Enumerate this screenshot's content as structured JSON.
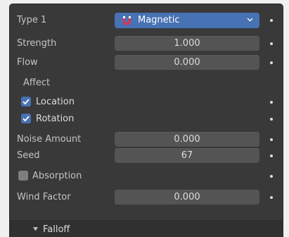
{
  "type": {
    "label": "Type 1",
    "value": "Magnetic",
    "icon": "magnet-icon"
  },
  "strength": {
    "label": "Strength",
    "value": "1.000"
  },
  "flow": {
    "label": "Flow",
    "value": "0.000"
  },
  "affect": {
    "label": "Affect",
    "location": {
      "label": "Location",
      "checked": true
    },
    "rotation": {
      "label": "Rotation",
      "checked": true
    }
  },
  "noise_amount": {
    "label": "Noise Amount",
    "value": "0.000"
  },
  "seed": {
    "label": "Seed",
    "value": "67"
  },
  "absorption": {
    "label": "Absorption",
    "checked": false
  },
  "wind_factor": {
    "label": "Wind Factor",
    "value": "0.000"
  },
  "falloff": {
    "label": "Falloff",
    "expanded": false
  },
  "colors": {
    "panel_bg": "#393939",
    "field_bg": "#545454",
    "accent": "#4772b3",
    "text": "#dcdcdc",
    "label_text": "#c4c4c4"
  }
}
